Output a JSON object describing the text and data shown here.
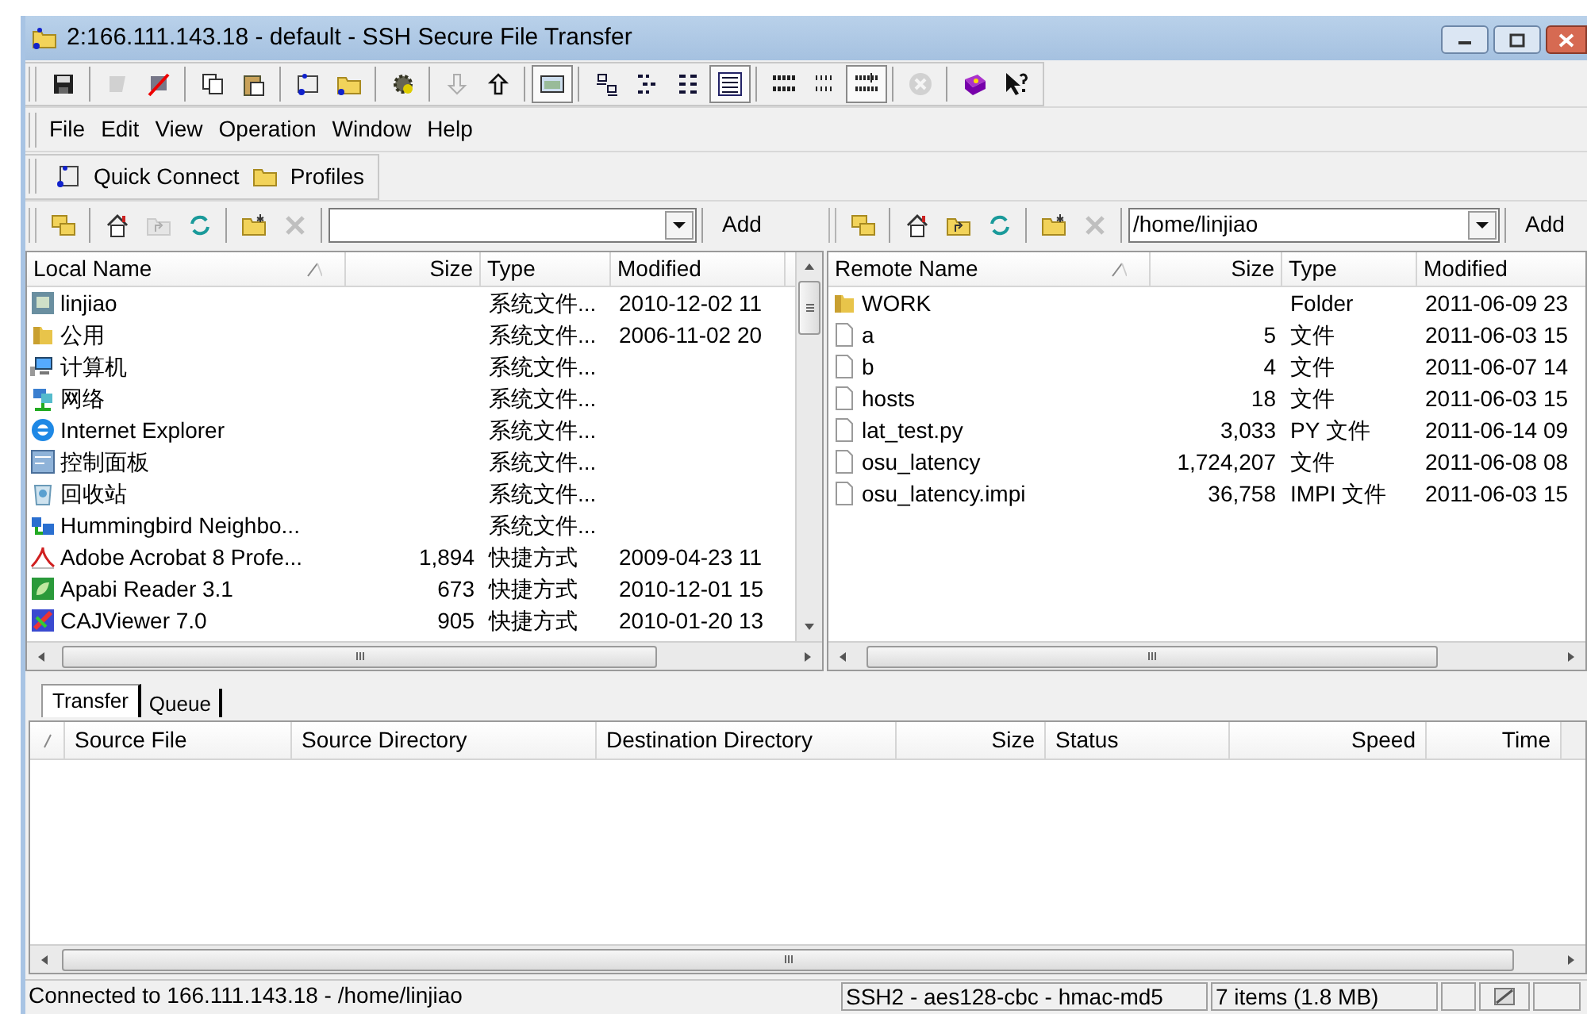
{
  "window": {
    "title": "2:166.111.143.18 - default - SSH Secure File Transfer"
  },
  "toolbar": {
    "groups": [
      [
        {
          "disabled": false,
          "pressed": false
        }
      ],
      [
        {
          "disabled": true,
          "pressed": false
        },
        {
          "disabled": false,
          "pressed": false
        }
      ],
      [
        {
          "disabled": false,
          "pressed": false
        },
        {
          "disabled": false,
          "pressed": false
        }
      ],
      [
        {
          "disabled": false,
          "pressed": false
        },
        {
          "disabled": false,
          "pressed": false
        }
      ],
      [
        {
          "disabled": false,
          "pressed": false
        }
      ],
      [
        {
          "disabled": true,
          "pressed": false
        },
        {
          "disabled": false,
          "pressed": false
        }
      ],
      [
        {
          "disabled": false,
          "pressed": true
        }
      ],
      [
        {
          "disabled": false,
          "pressed": false
        },
        {
          "disabled": false,
          "pressed": false
        },
        {
          "disabled": false,
          "pressed": false
        },
        {
          "disabled": false,
          "pressed": true
        }
      ],
      [
        {
          "disabled": false,
          "pressed": false
        },
        {
          "disabled": false,
          "pressed": false
        },
        {
          "disabled": false,
          "pressed": true
        }
      ],
      [
        {
          "disabled": true,
          "pressed": false
        }
      ],
      [
        {
          "disabled": false,
          "pressed": false
        },
        {
          "disabled": false,
          "pressed": false
        }
      ]
    ]
  },
  "menu": [
    "File",
    "Edit",
    "View",
    "Operation",
    "Window",
    "Help"
  ],
  "quick_bar": [
    "Quick Connect",
    "Profiles"
  ],
  "local_nav": {
    "add": "Add",
    "buttons": [
      {
        "disabled": false
      },
      {
        "disabled": false
      },
      {
        "disabled": true
      },
      {
        "disabled": false
      },
      {
        "disabled": false
      },
      {
        "disabled": true
      }
    ]
  },
  "remote_nav": {
    "path": "/home/linjiao",
    "add": "Add",
    "buttons": [
      {
        "disabled": false
      },
      {
        "disabled": false
      },
      {
        "disabled": false
      },
      {
        "disabled": false
      },
      {
        "disabled": false
      },
      {
        "disabled": true
      }
    ]
  },
  "local_pane": {
    "columns": [
      "Local Name",
      "Size",
      "Type",
      "Modified"
    ],
    "rows": [
      {
        "name": "linjiao",
        "size": "",
        "type": "系统文件...",
        "modified": "2010-12-02 11"
      },
      {
        "name": "公用",
        "size": "",
        "type": "系统文件...",
        "modified": "2006-11-02 20"
      },
      {
        "name": "计算机",
        "size": "",
        "type": "系统文件...",
        "modified": ""
      },
      {
        "name": "网络",
        "size": "",
        "type": "系统文件...",
        "modified": ""
      },
      {
        "name": "Internet Explorer",
        "size": "",
        "type": "系统文件...",
        "modified": ""
      },
      {
        "name": "控制面板",
        "size": "",
        "type": "系统文件...",
        "modified": ""
      },
      {
        "name": "回收站",
        "size": "",
        "type": "系统文件...",
        "modified": ""
      },
      {
        "name": "Hummingbird Neighbo...",
        "size": "",
        "type": "系统文件...",
        "modified": ""
      },
      {
        "name": "Adobe Acrobat 8 Profe...",
        "size": "1,894",
        "type": "快捷方式",
        "modified": "2009-04-23 11"
      },
      {
        "name": "Apabi Reader 3.1",
        "size": "673",
        "type": "快捷方式",
        "modified": "2010-12-01 15"
      },
      {
        "name": "CAJViewer 7.0",
        "size": "905",
        "type": "快捷方式",
        "modified": "2010-01-20 13"
      }
    ]
  },
  "remote_pane": {
    "columns": [
      "Remote Name",
      "Size",
      "Type",
      "Modified"
    ],
    "rows": [
      {
        "kind": "folder",
        "name": "WORK",
        "size": "",
        "type": "Folder",
        "modified": "2011-06-09 23"
      },
      {
        "kind": "file",
        "name": "a",
        "size": "5",
        "type": "文件",
        "modified": "2011-06-03 15"
      },
      {
        "kind": "file",
        "name": "b",
        "size": "4",
        "type": "文件",
        "modified": "2011-06-07 14"
      },
      {
        "kind": "file",
        "name": "hosts",
        "size": "18",
        "type": "文件",
        "modified": "2011-06-03 15"
      },
      {
        "kind": "file",
        "name": "lat_test.py",
        "size": "3,033",
        "type": "PY 文件",
        "modified": "2011-06-14 09"
      },
      {
        "kind": "file",
        "name": "osu_latency",
        "size": "1,724,207",
        "type": "文件",
        "modified": "2011-06-08 08"
      },
      {
        "kind": "file",
        "name": "osu_latency.impi",
        "size": "36,758",
        "type": "IMPI 文件",
        "modified": "2011-06-03 15"
      }
    ]
  },
  "transfer_tabs": [
    {
      "label": "Transfer",
      "selected": true
    },
    {
      "label": "Queue",
      "selected": false
    }
  ],
  "transfer_table": {
    "columns": [
      "Source File",
      "Source Directory",
      "Destination Directory",
      "Size",
      "Status",
      "Speed",
      "Time"
    ]
  },
  "status_bar": [
    "Connected to 166.111.143.18 - /home/linjiao",
    "SSH2 - aes128-cbc - hmac-md5",
    "7 items (1.8 MB)"
  ]
}
